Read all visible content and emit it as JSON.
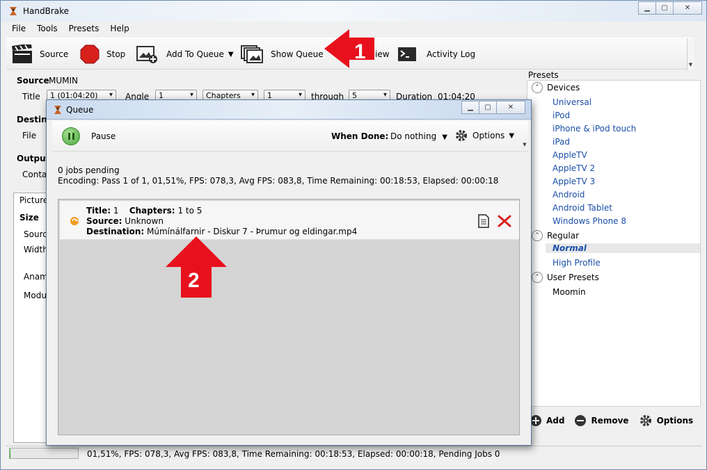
{
  "window": {
    "title": "HandBrake"
  },
  "menu": [
    "File",
    "Tools",
    "Presets",
    "Help"
  ],
  "toolbar": {
    "source": "Source",
    "stop": "Stop",
    "add_to_queue": "Add To Queue",
    "show_queue": "Show Queue",
    "preview_partial": "iew",
    "activity_log": "Activity Log"
  },
  "source_panel": {
    "source_label": "Source",
    "source_value": "MUMIN",
    "title_label": "Title",
    "title_value": "1 (01:04:20)",
    "angle_label": "Angle",
    "angle_value": "1",
    "chapters_mode": "Chapters",
    "chapter_start": "1",
    "through_label": "through",
    "chapter_end": "5",
    "duration_label": "Duration",
    "duration_value": "01:04:20",
    "destination_label": "Destinat",
    "file_label": "File",
    "output_label": "Output",
    "container_label": "Contai",
    "picture_tab": "Picture",
    "size_label": "Size",
    "source_size_label": "Source",
    "width_label": "Width",
    "anamorphic_label": "Anamo",
    "modulus_label": "Modu"
  },
  "presets": {
    "title": "Presets",
    "groups": [
      {
        "name": "Devices",
        "items": [
          "Universal",
          "iPod",
          "iPhone & iPod touch",
          "iPad",
          "AppleTV",
          "AppleTV 2",
          "AppleTV 3",
          "Android",
          "Android Tablet",
          "Windows Phone 8"
        ]
      },
      {
        "name": "Regular",
        "items": [
          "Normal",
          "High Profile"
        ]
      },
      {
        "name": "User Presets",
        "items": [
          "Moomin"
        ]
      }
    ],
    "selected": "Normal",
    "add": "Add",
    "remove": "Remove",
    "options": "Options"
  },
  "status": {
    "progress": 0.0151,
    "text": "01,51%,  FPS: 078,3,  Avg FPS: 083,8,  Time Remaining: 00:18:53,  Elapsed: 00:00:18,  Pending Jobs 0"
  },
  "queue": {
    "title": "Queue",
    "pause": "Pause",
    "when_done_label": "When Done:",
    "when_done_value": "Do nothing",
    "options": "Options",
    "jobs_pending": "0 jobs pending",
    "encoding": "Encoding: Pass 1 of 1,  01,51%, FPS: 078,3,  Avg FPS: 083,8,  Time Remaining: 00:18:53,  Elapsed: 00:00:18",
    "job": {
      "title_label": "Title:",
      "title_value": "1",
      "chapters_label": "Chapters:",
      "chapters_value": "1  to  5",
      "source_label": "Source:",
      "source_value": "Unknown",
      "destination_label": "Destination:",
      "destination_value": "Múmínálfarnir - Diskur 7 - Þrumur og eldingar.mp4"
    }
  },
  "callouts": [
    "1",
    "2"
  ],
  "colors": {
    "callout": "#e8101c",
    "preset_link": "#1a4ea8"
  }
}
